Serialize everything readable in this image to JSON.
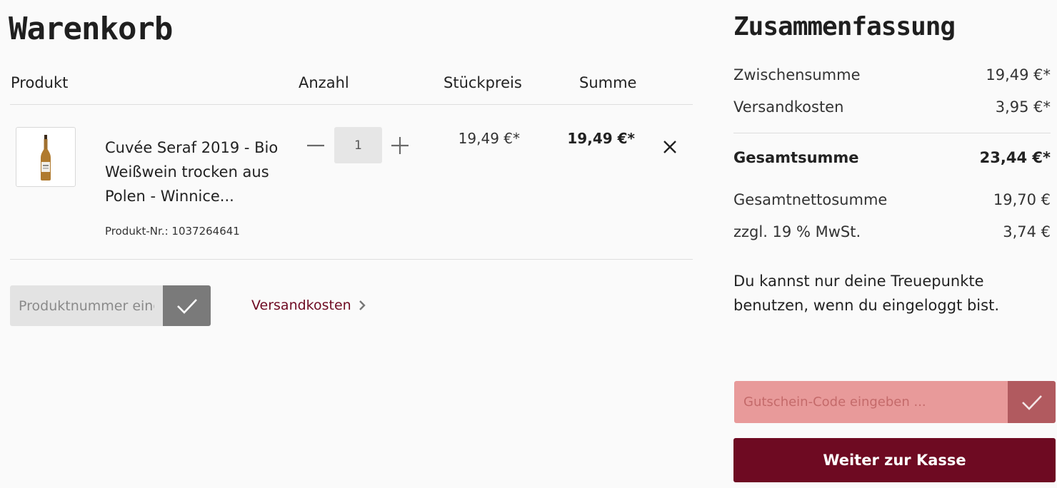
{
  "cart": {
    "title": "Warenkorb",
    "headers": {
      "product": "Produkt",
      "quantity": "Anzahl",
      "unit_price": "Stückpreis",
      "total": "Summe"
    },
    "items": [
      {
        "name": "Cuvée Seraf 2019 - Bio Weißwein trocken aus Polen - Winnice...",
        "product_number": "Produkt-Nr.: 1037264641",
        "quantity": "1",
        "unit_price": "19,49 €*",
        "total": "19,49 €*",
        "image_icon": "wine-bottle-icon"
      }
    ],
    "product_number_input": {
      "placeholder": "Produktnummer eingeben ..."
    },
    "shipping_link": "Versandkosten"
  },
  "summary": {
    "title": "Zusammenfassung",
    "subtotal_label": "Zwischensumme",
    "subtotal_value": "19,49 €*",
    "shipping_label": "Versandkosten",
    "shipping_value": "3,95 €*",
    "grand_total_label": "Gesamtsumme",
    "grand_total_value": "23,44 €*",
    "net_total_label": "Gesamtnettosumme",
    "net_total_value": "19,70 €",
    "vat_label": "zzgl. 19 % MwSt.",
    "vat_value": "3,74 €",
    "loyalty_note": "Du kannst nur deine Treuepunkte benutzen, wenn du eingeloggt bist.",
    "voucher_input": {
      "placeholder": "Gutschein-Code eingeben ..."
    },
    "checkout_label": "Weiter zur Kasse"
  },
  "colors": {
    "brand": "#6e0a22",
    "voucher_bg": "#e89a9a",
    "voucher_button": "#b15a5f",
    "product_submit": "#7a7a7a",
    "input_bg": "#e3e3e3"
  }
}
